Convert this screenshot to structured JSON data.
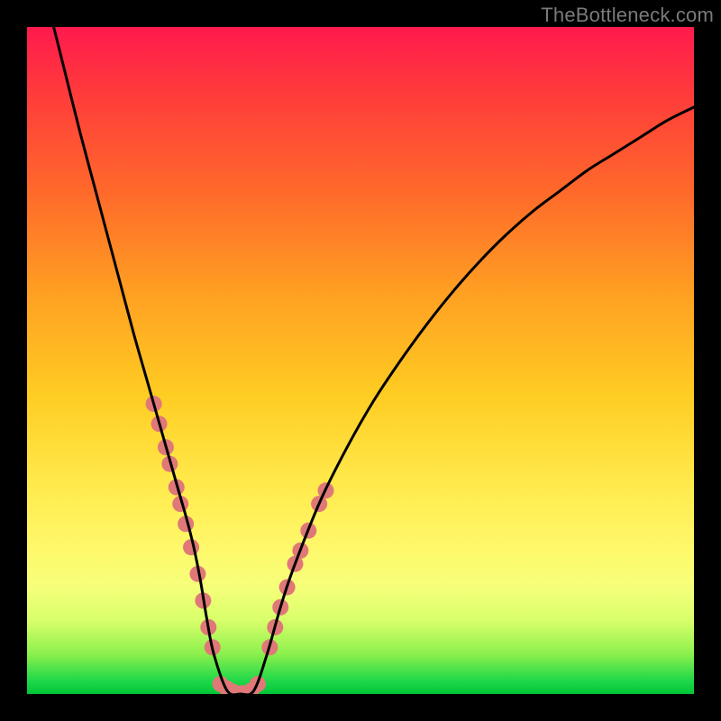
{
  "watermark": "TheBottleneck.com",
  "chart_data": {
    "type": "line",
    "title": "",
    "xlabel": "",
    "ylabel": "",
    "xlim": [
      0,
      100
    ],
    "ylim": [
      0,
      100
    ],
    "grid": false,
    "background_gradient_top": "#ff1a4d",
    "background_gradient_bottom": "#00c637",
    "series": [
      {
        "name": "curve",
        "color": "#000000",
        "stroke_width": 3,
        "x": [
          4,
          6,
          8,
          10,
          12,
          14,
          16,
          18,
          20,
          22,
          23,
          24,
          25,
          26,
          27,
          28,
          30,
          32,
          34,
          36,
          38,
          40,
          44,
          48,
          52,
          56,
          60,
          64,
          68,
          72,
          76,
          80,
          84,
          88,
          92,
          96,
          100
        ],
        "values": [
          100,
          92,
          84,
          76.5,
          69,
          61.5,
          54,
          47,
          40,
          33,
          29.5,
          26,
          22,
          17,
          11,
          6,
          0.5,
          0,
          0.5,
          6,
          13,
          19,
          29,
          37,
          44,
          50,
          55.5,
          60.5,
          65,
          69,
          72.5,
          75.5,
          78.5,
          81,
          83.5,
          86,
          88
        ]
      }
    ],
    "markers": [
      {
        "name": "left-dots",
        "color": "#e07878",
        "radius": 9,
        "x": [
          19.0,
          19.8,
          20.8,
          21.4,
          22.4,
          23.0,
          23.8,
          24.6,
          25.6,
          26.4,
          27.2,
          27.8
        ],
        "values": [
          43.5,
          40.5,
          37.0,
          34.5,
          31.0,
          28.5,
          25.5,
          22.0,
          18.0,
          14.0,
          10.0,
          7.0
        ]
      },
      {
        "name": "bottom-dots",
        "color": "#e07878",
        "radius": 9,
        "x": [
          29.0,
          30.0,
          31.0,
          32.3,
          33.6,
          34.6
        ],
        "values": [
          1.5,
          0.8,
          0.3,
          0.1,
          0.5,
          1.5
        ]
      },
      {
        "name": "right-dots",
        "color": "#e07878",
        "radius": 9,
        "x": [
          36.4,
          37.2,
          38.0,
          39.0,
          40.2,
          41.0,
          42.2,
          43.8,
          44.8
        ],
        "values": [
          7.0,
          10.0,
          13.0,
          16.0,
          19.5,
          21.5,
          24.5,
          28.5,
          30.5
        ]
      }
    ]
  }
}
